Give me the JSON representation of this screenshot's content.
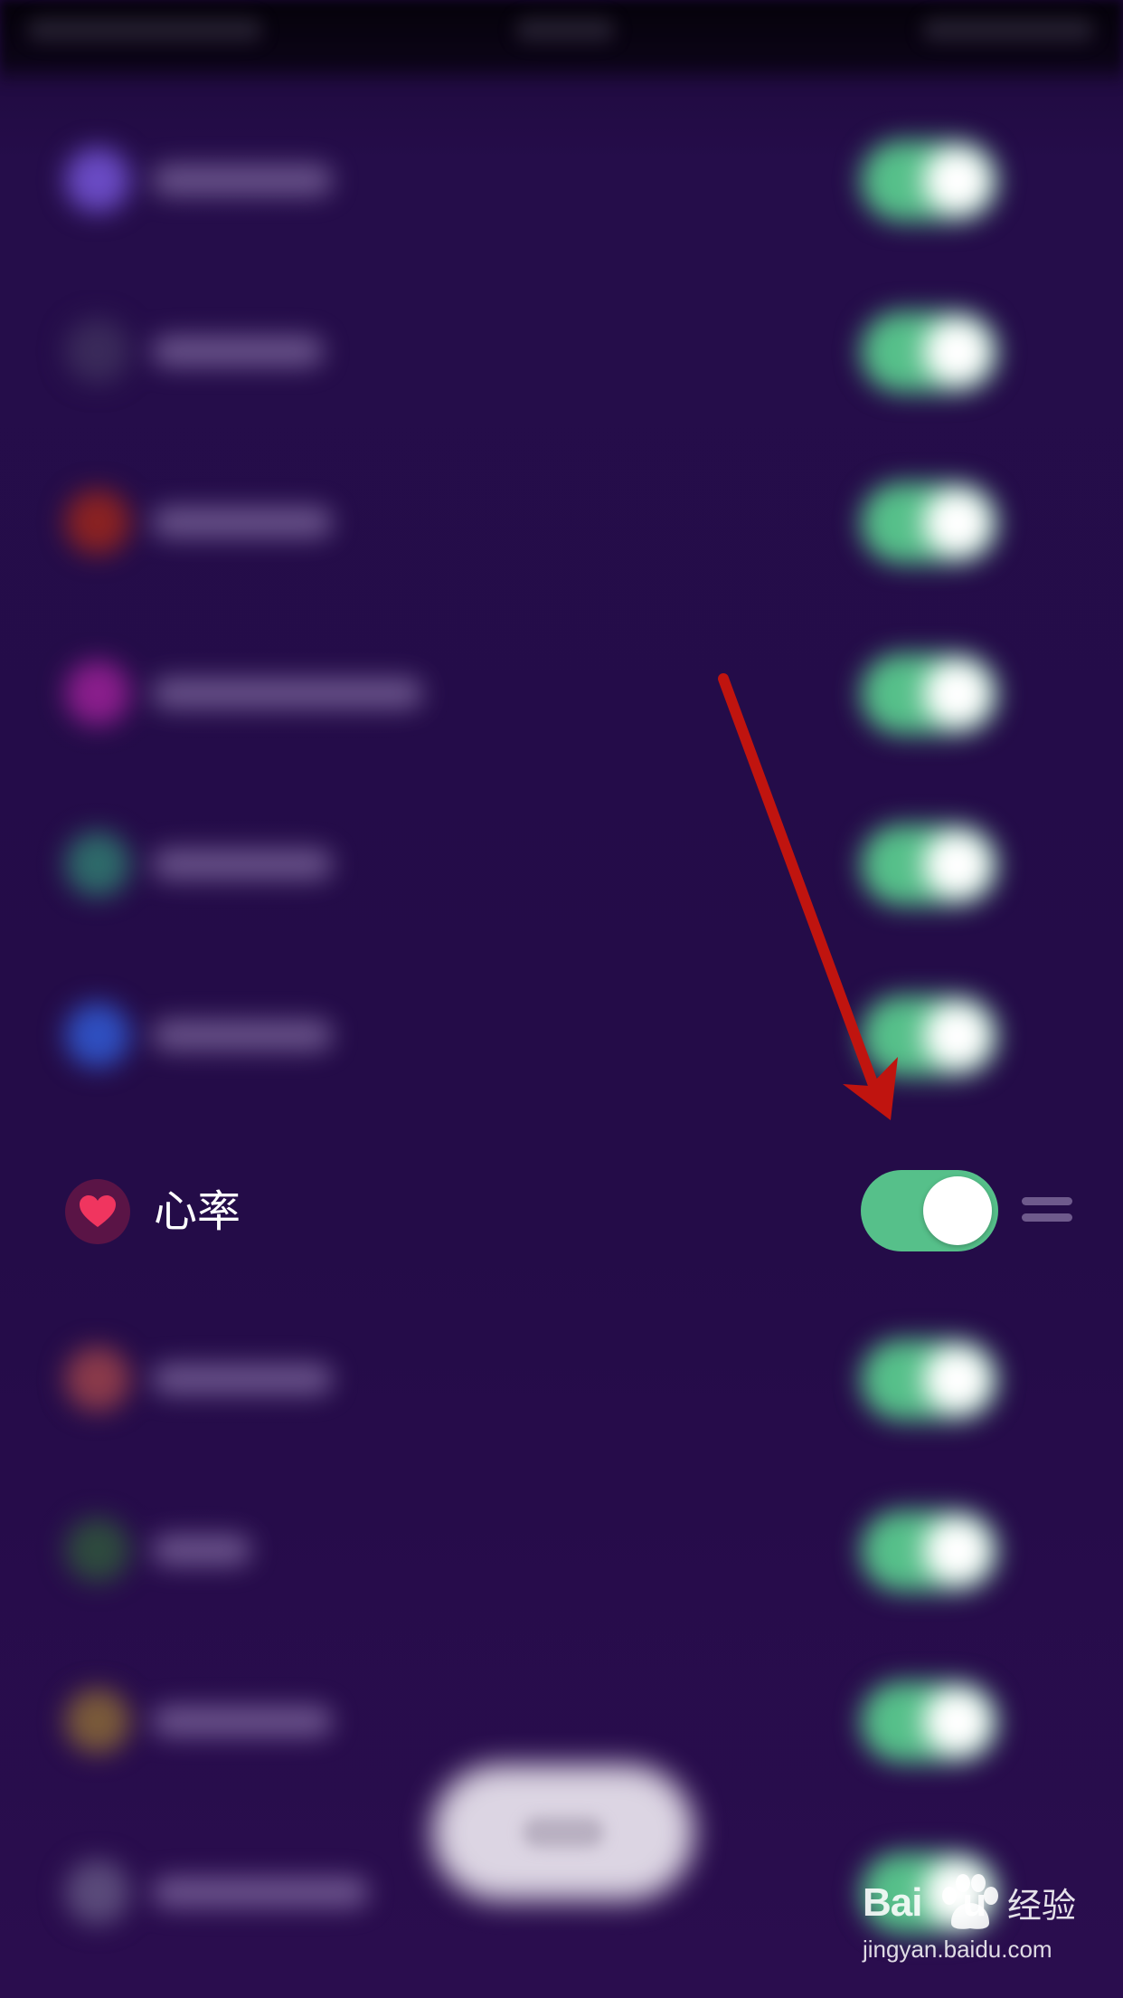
{
  "focused_item": {
    "label": "心率",
    "icon": "heart-icon",
    "toggle_on": true
  },
  "blurred_items_toggle_states": [
    true,
    true,
    true,
    true,
    true,
    true,
    true,
    true,
    true,
    true
  ],
  "colors": {
    "background": "#240c48",
    "toggle_on": "#56c08a",
    "heart": "#f0355f",
    "heart_circle": "#5a1446",
    "annotation_arrow": "#c0140f"
  },
  "watermark": {
    "brand": "Baidu",
    "brand_cn": "经验",
    "url": "jingyan.baidu.com"
  }
}
